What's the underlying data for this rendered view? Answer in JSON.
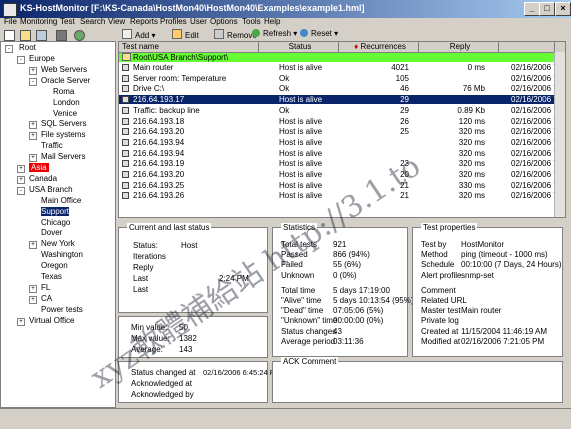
{
  "window": {
    "title": "KS-HostMonitor  [F:\\KS-Canada\\HostMon40\\HostMon40\\Examples\\example1.hml]",
    "controls": [
      "_",
      "□",
      "×"
    ]
  },
  "menu": [
    "File",
    "Monitoring",
    "Test",
    "Search",
    "View",
    "Reports",
    "Profiles",
    "User",
    "Options",
    "Tools",
    "Help"
  ],
  "toolbar": {
    "add": "Add",
    "edit": "Edit",
    "remove": "Remove",
    "refresh": "Refresh",
    "reset": "Reset"
  },
  "tree": {
    "root": "Root",
    "items": [
      {
        "label": "Europe",
        "level": 1,
        "exp": "-"
      },
      {
        "label": "Web Servers",
        "level": 2,
        "exp": "+"
      },
      {
        "label": "Oracle Server",
        "level": 2,
        "exp": "-"
      },
      {
        "label": "Roma",
        "level": 3,
        "exp": ""
      },
      {
        "label": "London",
        "level": 3,
        "exp": ""
      },
      {
        "label": "Venice",
        "level": 3,
        "exp": ""
      },
      {
        "label": "SQL Servers",
        "level": 2,
        "exp": "+"
      },
      {
        "label": "File systems",
        "level": 2,
        "exp": "+"
      },
      {
        "label": "Traffic",
        "level": 2,
        "exp": ""
      },
      {
        "label": "Mail Servers",
        "level": 2,
        "exp": "+"
      },
      {
        "label": "Asia",
        "level": 1,
        "exp": "+",
        "flag": true
      },
      {
        "label": "Canada",
        "level": 1,
        "exp": "+"
      },
      {
        "label": "USA Branch",
        "level": 1,
        "exp": "-"
      },
      {
        "label": "Main Office",
        "level": 2,
        "exp": ""
      },
      {
        "label": "Support",
        "level": 2,
        "exp": "",
        "selected": true
      },
      {
        "label": "Chicago",
        "level": 2,
        "exp": ""
      },
      {
        "label": "Dover",
        "level": 2,
        "exp": ""
      },
      {
        "label": "New York",
        "level": 2,
        "exp": "+"
      },
      {
        "label": "Washington",
        "level": 2,
        "exp": ""
      },
      {
        "label": "Oregon",
        "level": 2,
        "exp": ""
      },
      {
        "label": "Texas",
        "level": 2,
        "exp": ""
      },
      {
        "label": "FL",
        "level": 2,
        "exp": "+"
      },
      {
        "label": "CA",
        "level": 2,
        "exp": "+"
      },
      {
        "label": "Power tests",
        "level": 2,
        "exp": ""
      },
      {
        "label": "Virtual Office",
        "level": 1,
        "exp": "+"
      }
    ]
  },
  "list": {
    "columns": [
      "Test name",
      "Status",
      "Recurrences",
      "Reply",
      ""
    ],
    "group_row": "Root\\USA Branch\\Support\\",
    "rows": [
      {
        "name": "Main router",
        "status": "Host is alive",
        "rec": "4021",
        "reply": "0 ms",
        "date": "02/16/2006 7"
      },
      {
        "name": "Server room: Temperature",
        "status": "Ok",
        "rec": "105",
        "reply": "",
        "date": "02/16/2006 7"
      },
      {
        "name": "Drive C:\\",
        "status": "Ok",
        "rec": "46",
        "reply": "76 Mb",
        "date": "02/16/2006 7"
      },
      {
        "name": "216.64.193.17",
        "status": "Host is alive",
        "rec": "29",
        "reply": "",
        "date": "02/16/2006 7",
        "selected": true
      },
      {
        "name": "Traffic: backup line",
        "status": "Ok",
        "rec": "29",
        "reply": "0.89 Kb",
        "date": "02/16/2006 7"
      },
      {
        "name": "216.64.193.18",
        "status": "Host is alive",
        "rec": "26",
        "reply": "120 ms",
        "date": "02/16/2006 7"
      },
      {
        "name": "216.64.193.20",
        "status": "Host is alive",
        "rec": "25",
        "reply": "320 ms",
        "date": "02/16/2006 7"
      },
      {
        "name": "216.64.193.94",
        "status": "Host is alive",
        "rec": "",
        "reply": "320 ms",
        "date": "02/16/2006 7"
      },
      {
        "name": "216.64.193.94",
        "status": "Host is alive",
        "rec": "",
        "reply": "320 ms",
        "date": "02/16/2006 7"
      },
      {
        "name": "216.64.193.19",
        "status": "Host is alive",
        "rec": "23",
        "reply": "320 ms",
        "date": "02/16/2006 7"
      },
      {
        "name": "216.64.193.20",
        "status": "Host is alive",
        "rec": "20",
        "reply": "320 ms",
        "date": "02/16/2006 7"
      },
      {
        "name": "216.64.193.25",
        "status": "Host is alive",
        "rec": "21",
        "reply": "330 ms",
        "date": "02/16/2006 7"
      },
      {
        "name": "216.64.193.26",
        "status": "Host is alive",
        "rec": "21",
        "reply": "320 ms",
        "date": "02/16/2006 7"
      }
    ]
  },
  "current": {
    "title": "Current and last status",
    "status_label": "Status:",
    "status_value": "Host",
    "iterations": "Iterations",
    "reply": "Reply",
    "last_label": "Last",
    "last_value": "2:24 PM",
    "last2": "Last"
  },
  "reply_stats": {
    "min_label": "Min value:",
    "min_value": "50",
    "max_label": "Max value:",
    "max_value": "1382",
    "avg_label": "Average:",
    "avg_value": "143"
  },
  "status_changed": {
    "changed_label": "Status changed at",
    "changed_value": "02/16/2006 6:45:24 PM",
    "ack_label": "Acknowledged at",
    "ackby_label": "Acknowledged by"
  },
  "statistics": {
    "title": "Statistics",
    "rows": [
      {
        "label": "Total tests",
        "value": "921"
      },
      {
        "label": "Passed",
        "value": "866 (94%)"
      },
      {
        "label": "Failed",
        "value": "55 (6%)"
      },
      {
        "label": "Unknown",
        "value": "0 (0%)"
      },
      {
        "label": "Total time",
        "value": "5 days 17:19:00"
      },
      {
        "label": "\"Alive\" time",
        "value": "5 days 10:13:54 (95%)"
      },
      {
        "label": "\"Dead\" time",
        "value": "07:05:06 (5%)"
      },
      {
        "label": "\"Unknown\" time",
        "value": "00:00:00 (0%)"
      },
      {
        "label": "Status changes",
        "value": "43"
      },
      {
        "label": "Average period",
        "value": "03:11:36"
      }
    ]
  },
  "ack_comment": {
    "title": "ACK Comment"
  },
  "props": {
    "title": "Test properties",
    "rows": [
      {
        "label": "Test by",
        "value": "HostMonitor"
      },
      {
        "label": "Method",
        "value": "ping (timeout - 1000 ms)"
      },
      {
        "label": "Schedule",
        "value": "00:10:00 (7 Days, 24 Hours)"
      },
      {
        "label": "Alert profile",
        "value": "snmp-set"
      },
      {
        "label": "Comment",
        "value": ""
      },
      {
        "label": "Related URL",
        "value": ""
      },
      {
        "label": "Master test",
        "value": "Main router"
      },
      {
        "label": "Private log",
        "value": ""
      },
      {
        "label": "Created at",
        "value": "11/15/2004 11:46:19 AM"
      },
      {
        "label": "Modified at",
        "value": "02/16/2006 7:21:05 PM"
      }
    ]
  },
  "watermark": "xyz軟體補給站 http://3.1.to"
}
